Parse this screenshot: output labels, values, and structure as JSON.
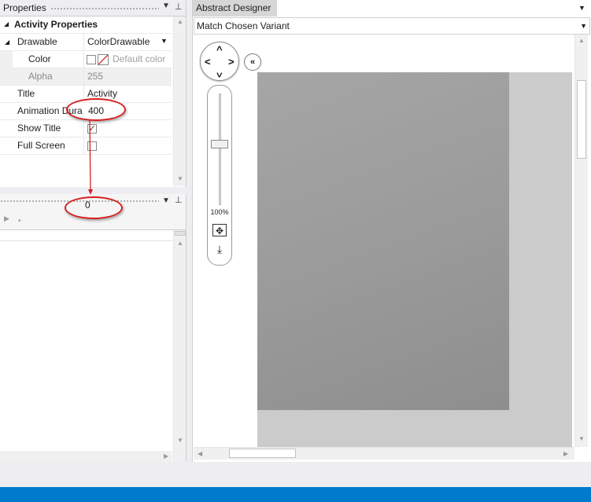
{
  "properties_panel": {
    "title": "Properties",
    "pin_glyph": "▾ ⊥",
    "section_header": "Activity Properties",
    "rows": [
      {
        "name": "Drawable",
        "value": "ColorDrawable"
      },
      {
        "name": "Color",
        "value": "Default color"
      },
      {
        "name": "Alpha",
        "value": "255"
      },
      {
        "name": "Title",
        "value": "Activity"
      },
      {
        "name": "Animation Dura",
        "value": "400"
      },
      {
        "name": "Show Title",
        "value": ""
      },
      {
        "name": "Full Screen",
        "value": ""
      }
    ],
    "show_title_checked": true,
    "full_screen_checked": false
  },
  "lower_panel": {
    "callout_value": "0"
  },
  "designer": {
    "tab_title": "Abstract Designer",
    "variant": "Match Chosen Variant",
    "zoom_label": "100%",
    "zoom_level_fraction": 0.55
  },
  "colors": {
    "status_bar": "#007acc",
    "callout": "#d62020",
    "device_outer": "#cbcbcb"
  }
}
